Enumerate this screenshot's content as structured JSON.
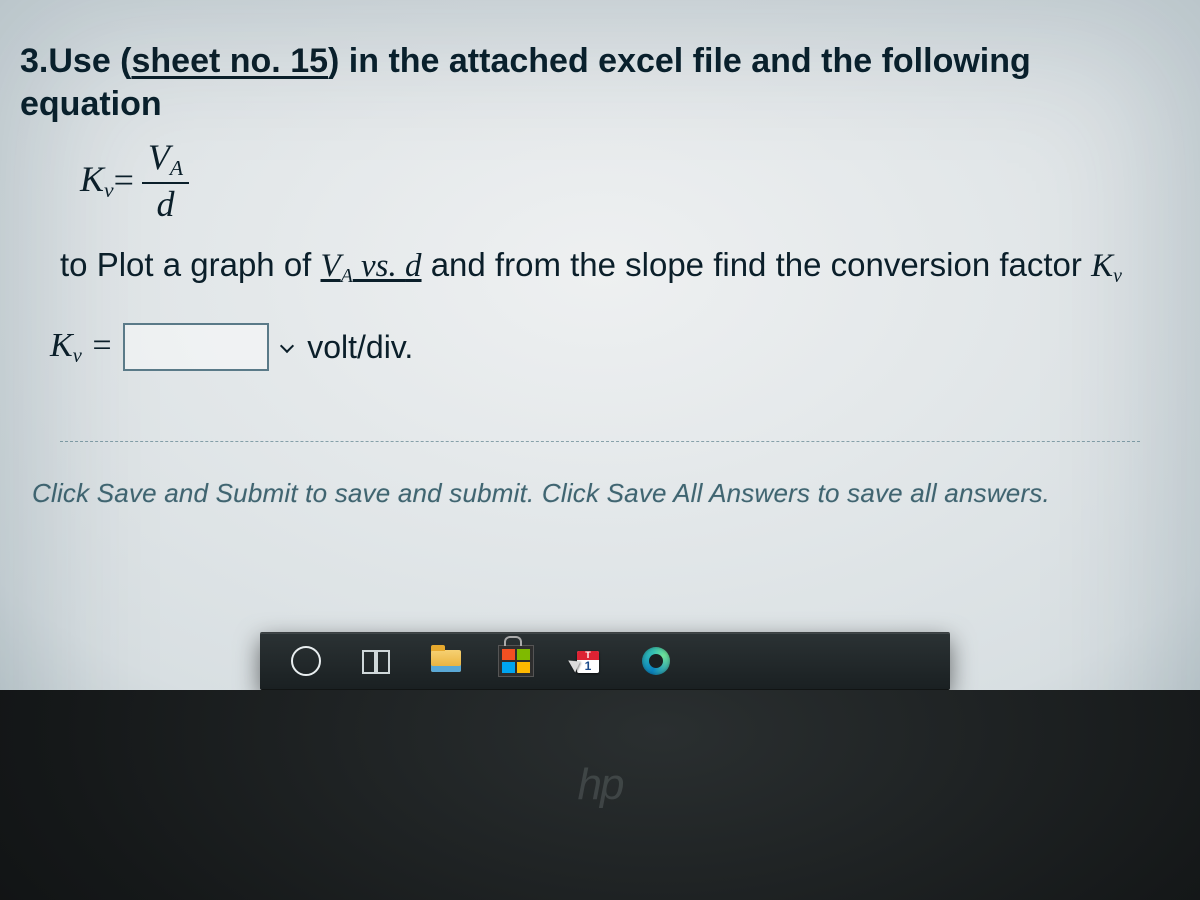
{
  "question": {
    "prefix": "3.Use (",
    "link_text": "sheet no. 15",
    "suffix": ") in the attached excel file and the following equation"
  },
  "equation": {
    "lhs_base": "K",
    "lhs_sub": "v",
    "eq": " = ",
    "num_base": "V",
    "num_sub": "A",
    "den": "d"
  },
  "plot_line": {
    "p1": "to Plot a graph of ",
    "u1_base": "V",
    "u1_sub": "A",
    "mid": " vs. ",
    "u2": "d",
    "p2": " and from the slope find the conversion factor ",
    "k_base": "K",
    "k_sub": "v"
  },
  "answer": {
    "label_base": "K",
    "label_sub": "v",
    "label_eq": " = ",
    "input_value": "",
    "unit": "volt/div."
  },
  "hint": "Click Save and Submit to save and submit. Click Save All Answers to save all answers.",
  "taskbar": {
    "cortana": "cortana-search",
    "taskview": "task-view",
    "explorer": "file-explorer",
    "store": "microsoft-store",
    "tracker": "tracker-app",
    "edge": "microsoft-edge"
  },
  "watermark": "hp"
}
